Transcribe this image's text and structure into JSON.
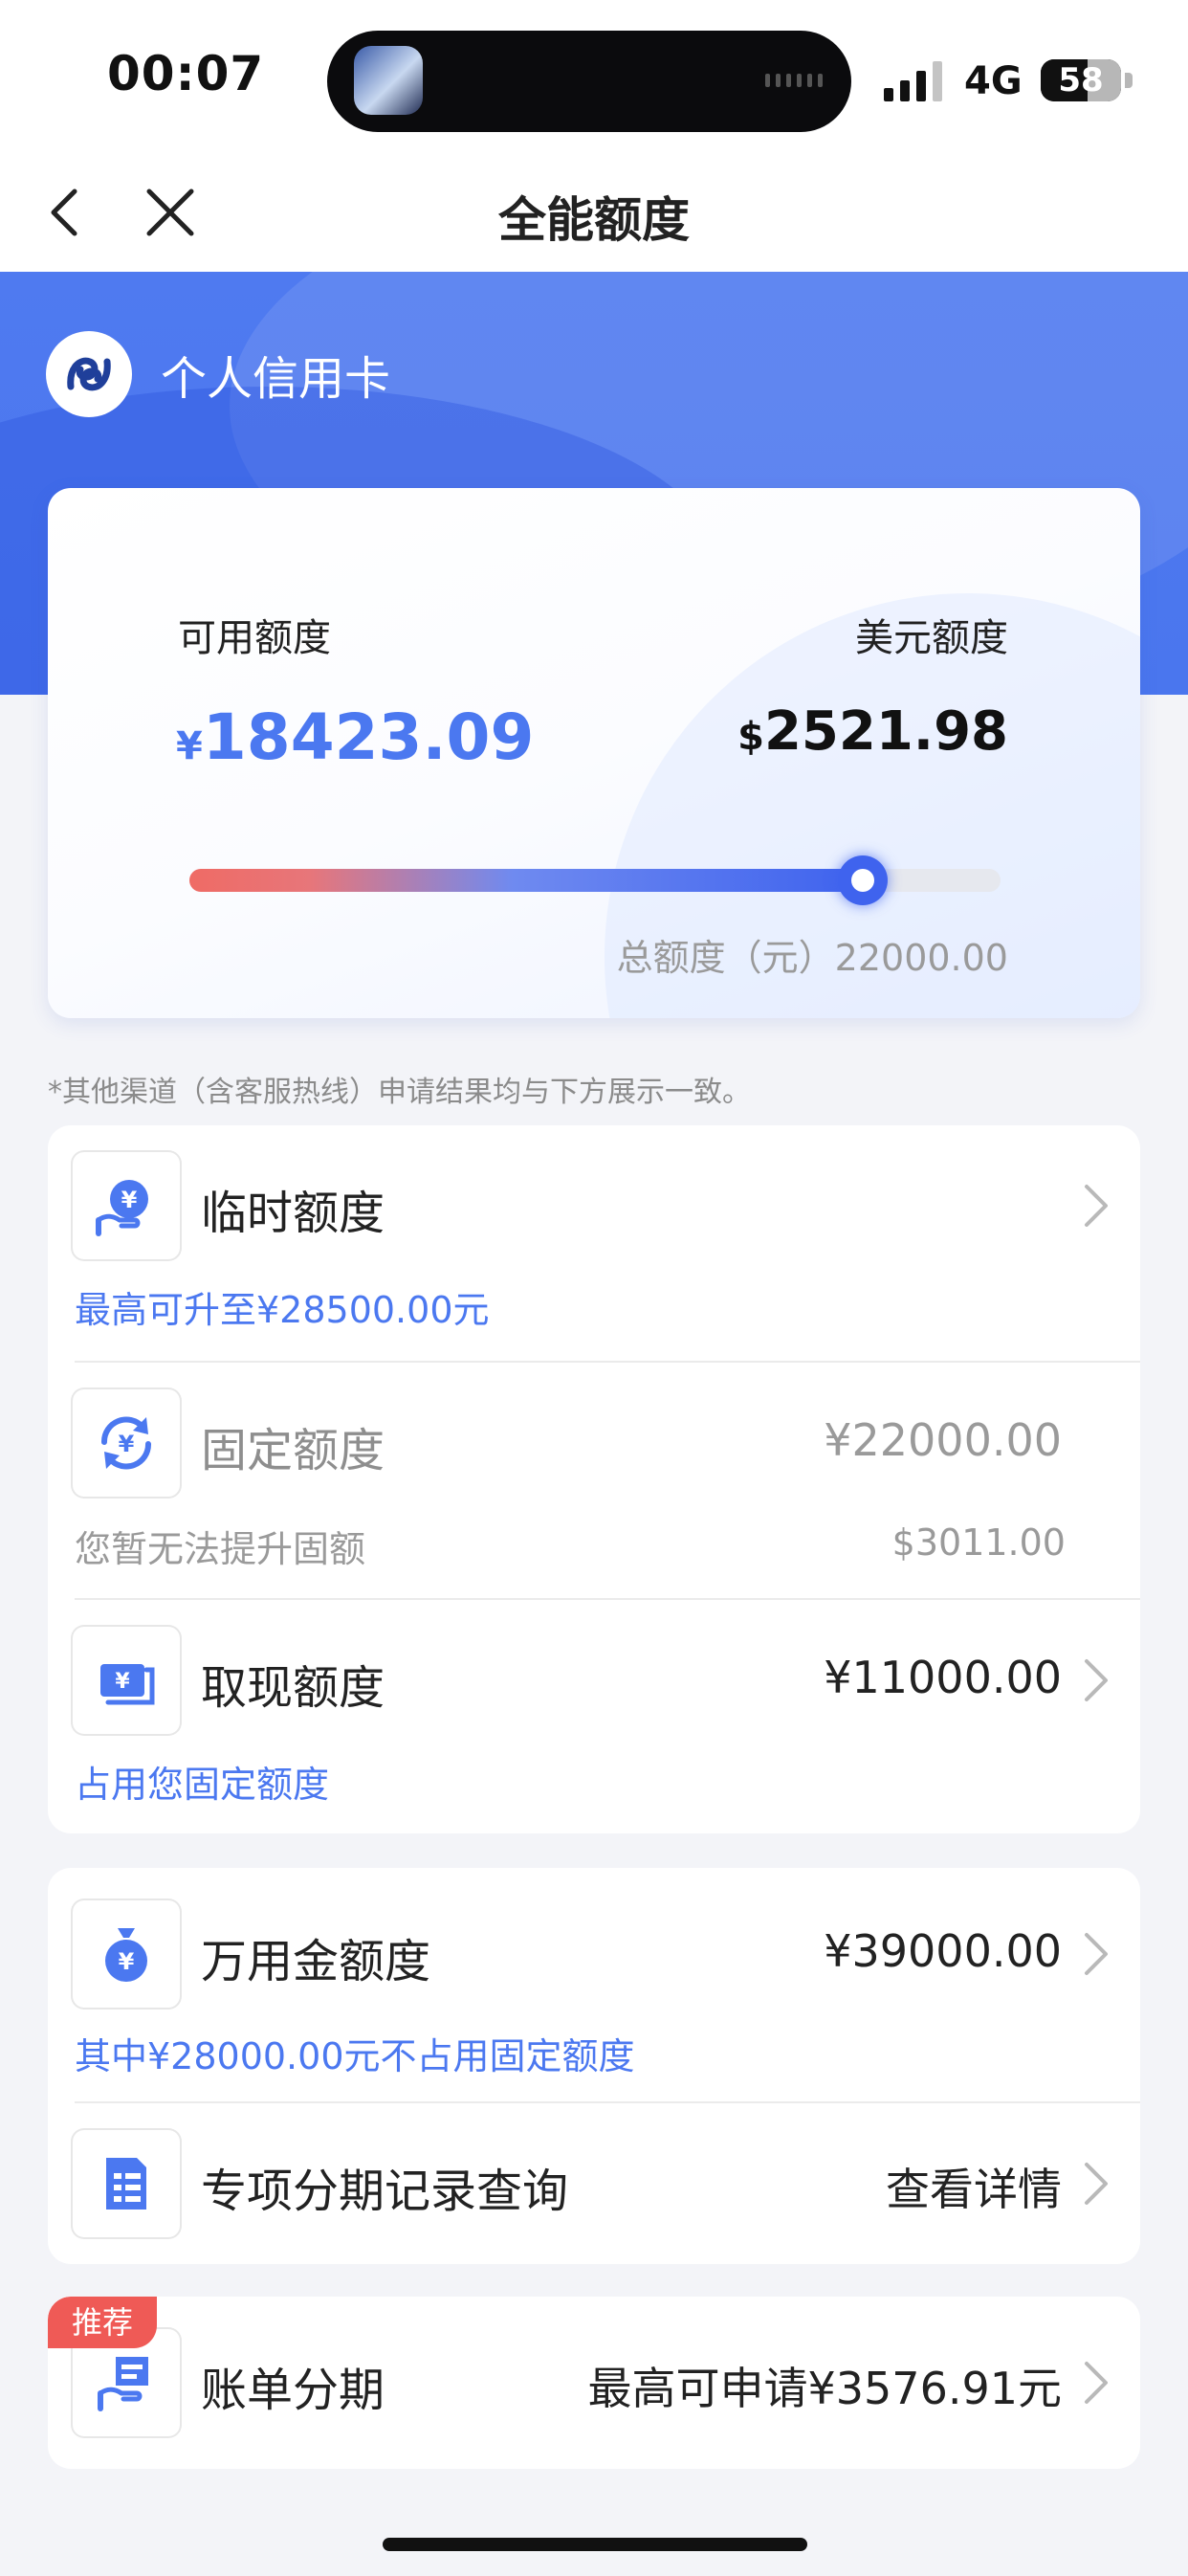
{
  "status_bar": {
    "time": "00:07",
    "network": "4G",
    "battery": "58"
  },
  "nav": {
    "title": "全能额度"
  },
  "hero": {
    "card_type": "个人信用卡"
  },
  "limit_card": {
    "available_label": "可用额度",
    "available_currency": "¥",
    "available_amount": "18423.09",
    "usd_label": "美元额度",
    "usd_currency": "$",
    "usd_amount": "2521.98",
    "usage_fraction": 0.83,
    "total_label": "总额度（元）22000.00"
  },
  "notice": "*其他渠道（含客服热线）申请结果均与下方展示一致。",
  "panel1": {
    "temp": {
      "icon": "hand-yen-icon",
      "title": "临时额度",
      "sub": "最高可升至¥28500.00元"
    },
    "fixed": {
      "icon": "yen-cycle-icon",
      "title": "固定额度",
      "value": "¥22000.00",
      "sub": "您暂无法提升固额",
      "value_usd": "$3011.00"
    },
    "cash": {
      "icon": "banknote-icon",
      "title": "取现额度",
      "value": "¥11000.00",
      "sub": "占用您固定额度"
    }
  },
  "panel2": {
    "wanyongjin": {
      "icon": "money-bag-icon",
      "title": "万用金额度",
      "value": "¥39000.00",
      "sub": "其中¥28000.00元不占用固定额度"
    },
    "installment_record": {
      "icon": "document-list-icon",
      "title": "专项分期记录查询",
      "value": "查看详情"
    }
  },
  "panel3": {
    "badge": "推荐",
    "bill_installment": {
      "icon": "bill-hand-icon",
      "title": "账单分期",
      "value": "最高可申请¥3576.91元"
    }
  },
  "colors": {
    "brand_blue": "#4b78f0",
    "hero_blue": "#4f7af0",
    "badge_red": "#ef5a56"
  }
}
